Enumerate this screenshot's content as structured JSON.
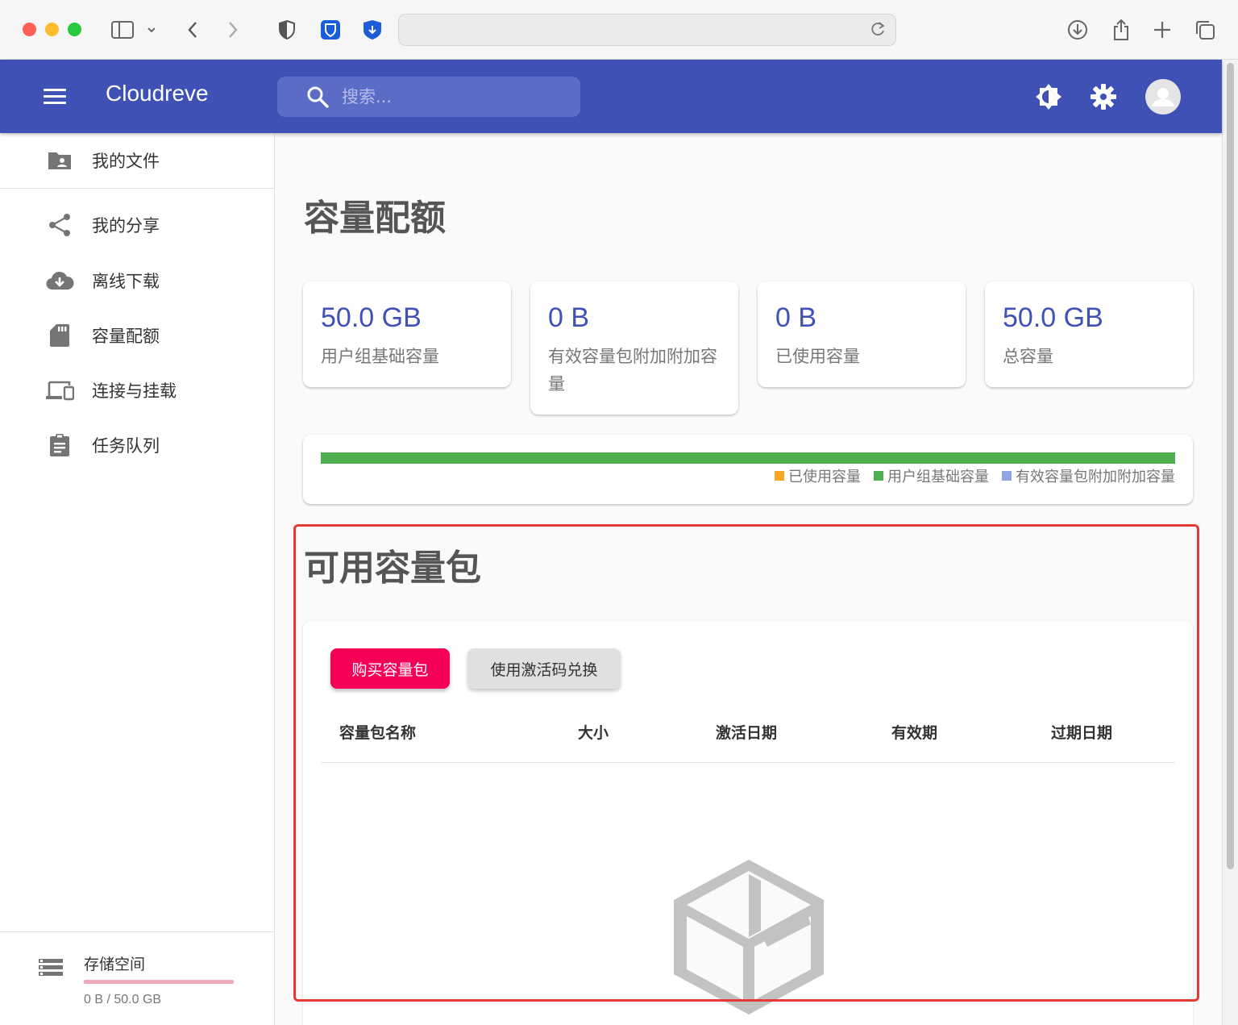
{
  "app": {
    "brand": "Cloudreve",
    "search_placeholder": "搜索..."
  },
  "sidebar": {
    "items": [
      {
        "label": "我的文件",
        "icon": "folder-user-icon"
      },
      {
        "label": "我的分享",
        "icon": "share-icon"
      },
      {
        "label": "离线下载",
        "icon": "cloud-download-icon"
      },
      {
        "label": "容量配额",
        "icon": "sd-card-icon"
      },
      {
        "label": "连接与挂载",
        "icon": "devices-icon"
      },
      {
        "label": "任务队列",
        "icon": "clipboard-icon"
      }
    ],
    "storage": {
      "title": "存储空间",
      "usage": "0 B / 50.0 GB",
      "used_fraction": 0.0
    }
  },
  "quota": {
    "title": "容量配额",
    "stats": [
      {
        "value": "50.0 GB",
        "label": "用户组基础容量"
      },
      {
        "value": "0 B",
        "label": "有效容量包附加附加容量"
      },
      {
        "value": "0 B",
        "label": "已使用容量"
      },
      {
        "value": "50.0 GB",
        "label": "总容量"
      }
    ],
    "legend": [
      {
        "label": "已使用容量",
        "color": "#f5a623"
      },
      {
        "label": "用户组基础容量",
        "color": "#4caf50"
      },
      {
        "label": "有效容量包附加附加容量",
        "color": "#8fa6e3"
      }
    ]
  },
  "packs": {
    "title": "可用容量包",
    "buy_label": "购买容量包",
    "redeem_label": "使用激活码兑换",
    "columns": [
      "容量包名称",
      "大小",
      "激活日期",
      "有效期",
      "过期日期"
    ]
  },
  "colors": {
    "primary": "#3f51b5",
    "accent": "#f50057",
    "usage_bar": "#4caf50",
    "highlight": "#e53935"
  }
}
